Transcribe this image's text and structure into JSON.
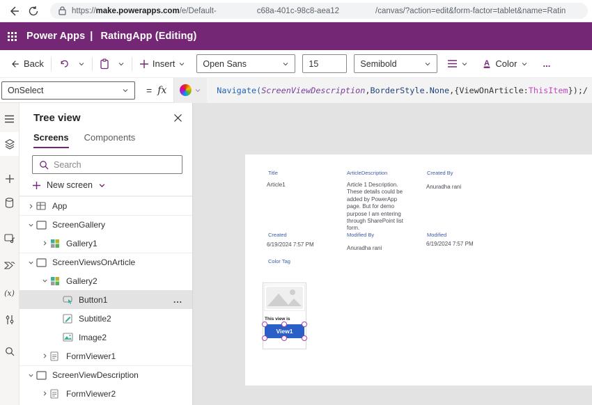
{
  "browser": {
    "url_scheme": "https://",
    "url_host": "make.powerapps.com",
    "url_path": "/e/Default-",
    "url_segment2": "c68a-401c-98c8-aea12",
    "url_segment3": "/canvas/?action=edit&form-factor=tablet&name=Ratin"
  },
  "header": {
    "brand": "Power Apps",
    "divider": "|",
    "title": "RatingApp (Editing)"
  },
  "toolbar": {
    "back_label": "Back",
    "insert_label": "Insert",
    "font_family_value": "Open Sans",
    "font_size_value": "15",
    "font_weight_value": "Semibold",
    "color_label": "Color",
    "overflow_label": "..."
  },
  "formula_bar": {
    "property": "OnSelect",
    "equals": "=",
    "fx_label": "fx",
    "code_segments": [
      {
        "text": "Navigate(",
        "color": "#2465b0",
        "italic": false
      },
      {
        "text": "ScreenViewDescription",
        "color": "#7a3e9d",
        "italic": true
      },
      {
        "text": ",",
        "color": "#333333",
        "italic": false
      },
      {
        "text": "BorderStyle",
        "color": "#20427a",
        "italic": false
      },
      {
        "text": ".",
        "color": "#333333",
        "italic": false
      },
      {
        "text": "None",
        "color": "#20427a",
        "italic": false
      },
      {
        "text": ",{",
        "color": "#333333",
        "italic": false
      },
      {
        "text": "ViewOnArticle:",
        "color": "#333333",
        "italic": false
      },
      {
        "text": "ThisItem",
        "color": "#c04ac0",
        "italic": false
      },
      {
        "text": "});/",
        "color": "#333333",
        "italic": false
      }
    ]
  },
  "tree_view": {
    "title": "Tree view",
    "tabs": [
      {
        "label": "Screens",
        "active": true
      },
      {
        "label": "Components",
        "active": false
      }
    ],
    "search_placeholder": "Search",
    "new_screen_label": "New screen",
    "items": [
      {
        "label": "App",
        "icon": "app",
        "level": 0,
        "chevron": "right",
        "top": true
      },
      {
        "label": "ScreenGallery",
        "icon": "screen",
        "level": 0,
        "chevron": "down",
        "top": true
      },
      {
        "label": "Gallery1",
        "icon": "gallery",
        "level": 1,
        "chevron": "right"
      },
      {
        "label": "ScreenViewsOnArticle",
        "icon": "screen",
        "level": 0,
        "chevron": "down",
        "top": true
      },
      {
        "label": "Gallery2",
        "icon": "gallery",
        "level": 1,
        "chevron": "down"
      },
      {
        "label": "Button1",
        "icon": "button",
        "level": 2,
        "selected": true,
        "menu": "..."
      },
      {
        "label": "Subtitle2",
        "icon": "text",
        "level": 2
      },
      {
        "label": "Image2",
        "icon": "image",
        "level": 2
      },
      {
        "label": "FormViewer1",
        "icon": "form",
        "level": 1,
        "chevron": "right"
      },
      {
        "label": "ScreenViewDescription",
        "icon": "screen",
        "level": 0,
        "chevron": "down",
        "top": true
      },
      {
        "label": "FormViewer2",
        "icon": "form",
        "level": 1,
        "chevron": "right"
      }
    ]
  },
  "canvas": {
    "fields": [
      {
        "label": "Title",
        "value": "Article1"
      },
      {
        "label": "ArticleDescription",
        "value": "Article 1 Description. These details could be added by PowerApp page. But for demo purpose I am entering through SharePoint list form."
      },
      {
        "label": "Created By",
        "value": "Anuradha rani"
      },
      {
        "label": "Created",
        "value": "6/19/2024 7:57 PM"
      },
      {
        "label": "Modified By",
        "value": "Anuradha rani"
      },
      {
        "label": "Modified",
        "value": "6/19/2024 7:57 PM"
      },
      {
        "label": "Color Tag",
        "value": ""
      }
    ],
    "gallery_item": {
      "caption": "This view is",
      "button_label": "View1"
    }
  },
  "colors": {
    "brand_purple": "#742774",
    "button_blue": "#2b5fc8",
    "canvas_gray": "#e3e3e3",
    "accent_teal": "#3aafa0"
  }
}
